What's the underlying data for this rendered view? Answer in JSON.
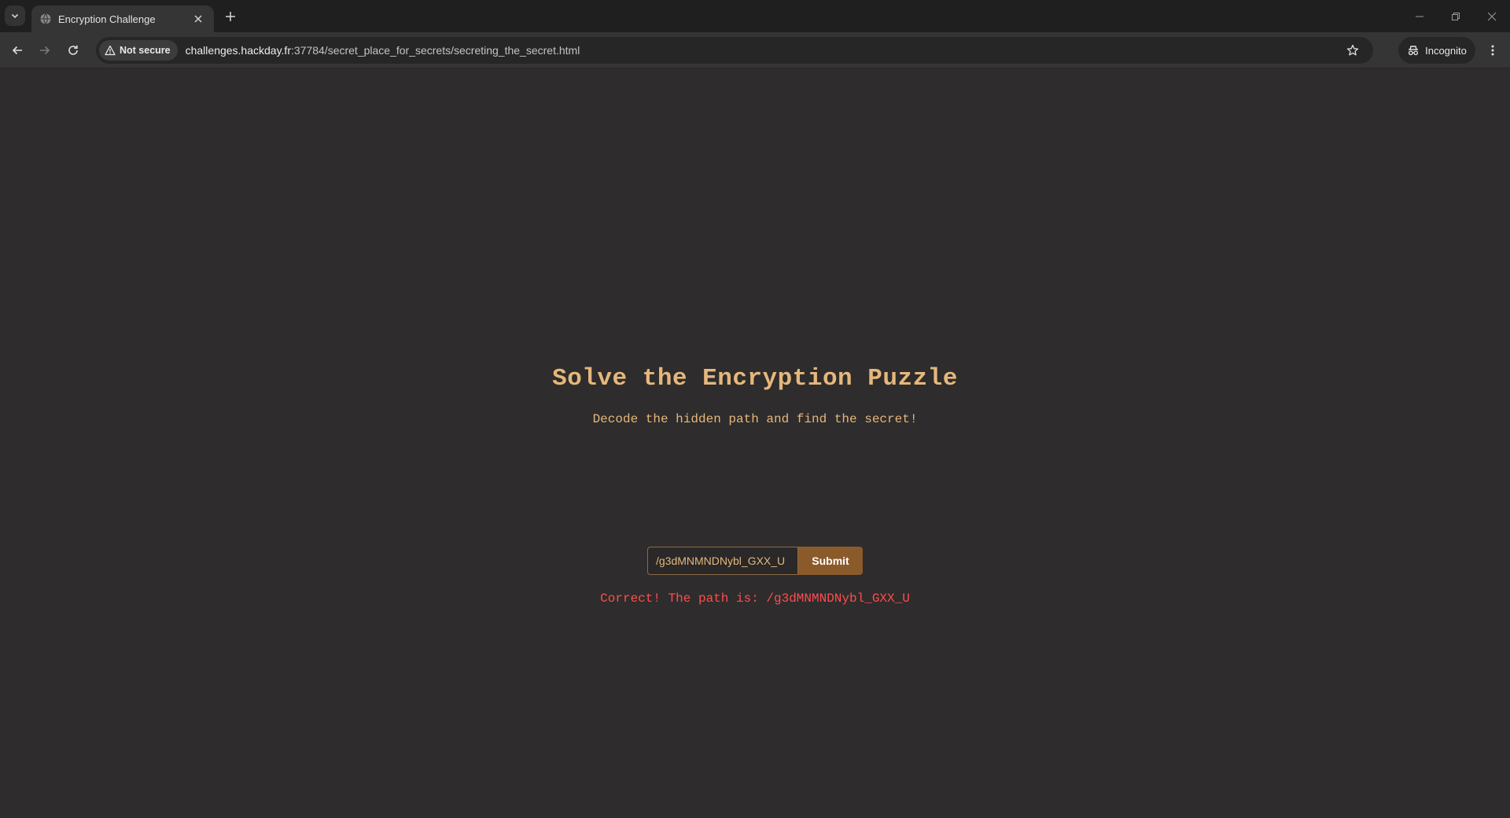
{
  "browser": {
    "tab": {
      "title": "Encryption Challenge"
    },
    "security_label": "Not secure",
    "url_host": "challenges.hackday.fr",
    "url_rest": ":37784/secret_place_for_secrets/secreting_the_secret.html",
    "incognito_label": "Incognito"
  },
  "page": {
    "heading": "Solve the Encryption Puzzle",
    "subtitle": "Decode the hidden path and find the secret!",
    "input_value": "/g3dMNMNDNybl_GXX_U",
    "submit_label": "Submit",
    "result_message": "Correct! The path is: /g3dMNMNDNybl_GXX_U"
  },
  "colors": {
    "page_bg": "#2e2c2c",
    "accent": "#e5b77c",
    "button": "#8b5a2b",
    "result": "#ff4d4d"
  }
}
